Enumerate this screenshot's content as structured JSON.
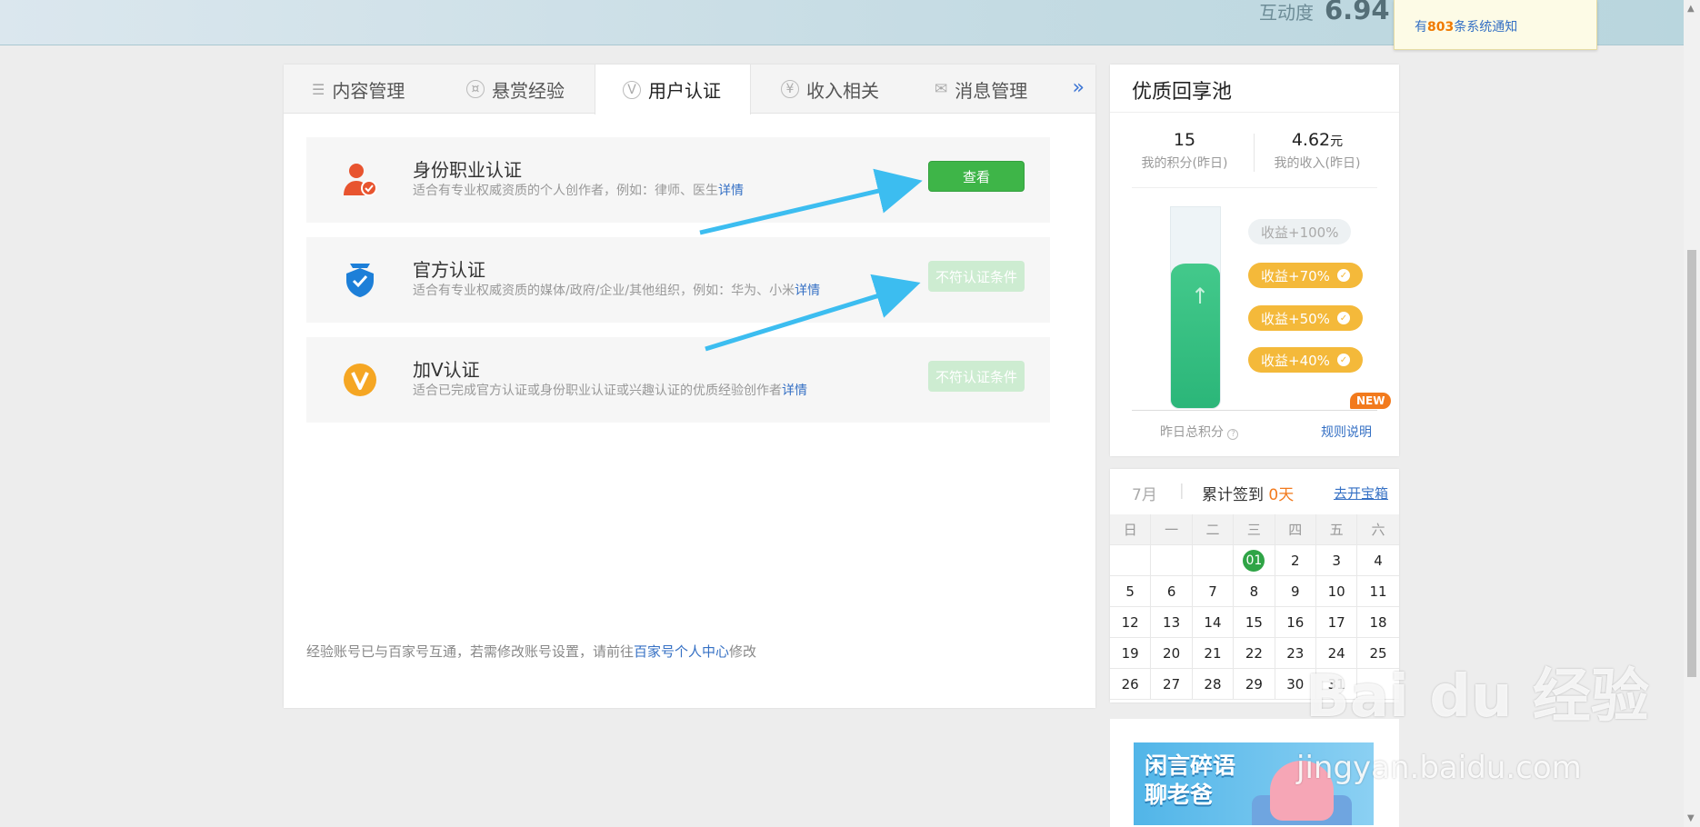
{
  "header": {
    "label": "互动度",
    "score": "6.94"
  },
  "notice": {
    "prefix": "有",
    "count": "803",
    "suffix": "条系统通知"
  },
  "tabs": [
    {
      "label": "内容管理",
      "icon": "list-icon"
    },
    {
      "label": "悬赏经验",
      "icon": "reward-icon"
    },
    {
      "label": "用户认证",
      "icon": "v-badge-icon"
    },
    {
      "label": "收入相关",
      "icon": "yen-icon"
    },
    {
      "label": "消息管理",
      "icon": "mail-icon"
    }
  ],
  "tab_more": "»",
  "cards": [
    {
      "title": "身份职业认证",
      "desc": "适合有专业权威资质的个人创作者，例如：律师、医生",
      "link": "详情",
      "button": "查看",
      "icon": "person-check-icon"
    },
    {
      "title": "官方认证",
      "desc": "适合有专业权威资质的媒体/政府/企业/其他组织，例如：华为、小米",
      "link": "详情",
      "button": "不符认证条件",
      "icon": "shield-check-icon"
    },
    {
      "title": "加V认证",
      "desc": "适合已完成官方认证或身份职业认证或兴趣认证的优质经验创作者",
      "link": "详情",
      "button": "不符认证条件",
      "icon": "v-icon"
    }
  ],
  "footer": {
    "prefix": "经验账号已与百家号互通，若需修改账号设置，请前往",
    "link": "百家号个人中心",
    "suffix": "修改"
  },
  "pool": {
    "title": "优质回享池",
    "points": "15",
    "points_label": "我的积分(昨日)",
    "income": "4.62",
    "income_unit": "元",
    "income_label": "我的收入(昨日)",
    "fill_level": 0.72,
    "tiers": [
      "收益+100%",
      "收益+70%",
      "收益+50%",
      "收益+40%"
    ],
    "total_label": "昨日总积分",
    "help_icon": "?",
    "rule_link": "规则说明",
    "new_badge": "NEW"
  },
  "calendar": {
    "month": "7月",
    "sep": "|",
    "checkin_label": "累计签到",
    "checkin_days": "0天",
    "open_box": "去开宝箱",
    "weekdays": [
      "日",
      "一",
      "二",
      "三",
      "四",
      "五",
      "六"
    ],
    "days": [
      [
        "",
        "",
        "",
        "01",
        "2",
        "3",
        "4"
      ],
      [
        "5",
        "6",
        "7",
        "8",
        "9",
        "10",
        "11"
      ],
      [
        "12",
        "13",
        "14",
        "15",
        "16",
        "17",
        "18"
      ],
      [
        "19",
        "20",
        "21",
        "22",
        "23",
        "24",
        "25"
      ],
      [
        "26",
        "27",
        "28",
        "29",
        "30",
        "31",
        ""
      ]
    ]
  },
  "banner": {
    "line1": "闲言碎语",
    "line2": "聊老爸"
  },
  "watermark": {
    "line1": "Bai du 经验",
    "line2": "jingyan.baidu.com"
  },
  "colors": {
    "accent": "#3570c4",
    "green": "#3eb548",
    "orange": "#f27a1d",
    "gold": "#f4b93a",
    "arrow": "#3cbdf0"
  }
}
